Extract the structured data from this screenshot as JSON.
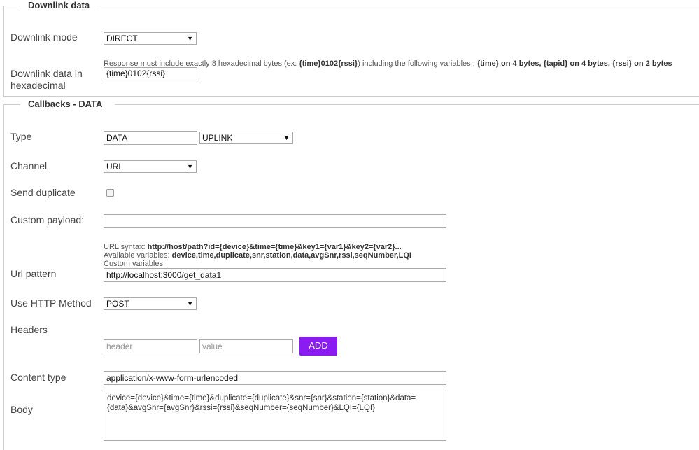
{
  "downlink": {
    "legend": "Downlink data",
    "mode_label": "Downlink mode",
    "mode_value": "DIRECT",
    "data_label_line1": "Downlink data in",
    "data_label_line2": "hexadecimal",
    "hint_pre": "Response must include exactly 8 hexadecimal bytes (ex: ",
    "hint_ex": "{time}0102{rssi}",
    "hint_mid": ") including the following variables : ",
    "hint_vars": "{time} on 4 bytes, {tapid} on 4 bytes, {rssi} on 2 bytes",
    "data_value": "{time}0102{rssi}"
  },
  "callbacks": {
    "legend": "Callbacks - DATA",
    "type_label": "Type",
    "type_value": "DATA",
    "type_select": "UPLINK",
    "channel_label": "Channel",
    "channel_value": "URL",
    "duplicate_label": "Send duplicate",
    "duplicate_checked": false,
    "custom_payload_label": "Custom payload:",
    "custom_payload_value": "",
    "url_syntax_prefix": "URL syntax: ",
    "url_syntax": "http://host/path?id={device}&time={time}&key1={var1}&key2={var2}...",
    "available_prefix": "Available variables: ",
    "available_vars": "device,time,duplicate,snr,station,data,avgSnr,rssi,seqNumber,LQI",
    "custom_vars": "Custom variables:",
    "url_pattern_label": "Url pattern",
    "url_pattern_value": "http://localhost:3000/get_data1",
    "http_method_label": "Use HTTP Method",
    "http_method_value": "POST",
    "headers_label": "Headers",
    "header_placeholder": "header",
    "value_placeholder": "value",
    "add_button": "ADD",
    "content_type_label": "Content type",
    "content_type_value": "application/x-www-form-urlencoded",
    "body_label": "Body",
    "body_value": "device={device}&time={time}&duplicate={duplicate}&snr={snr}&station={station}&data=\n{data}&avgSnr={avgSnr}&rssi={rssi}&seqNumber={seqNumber}&LQI={LQI}"
  },
  "colors": {
    "accent": "#8a1cf2",
    "border": "#cfcfcf"
  }
}
